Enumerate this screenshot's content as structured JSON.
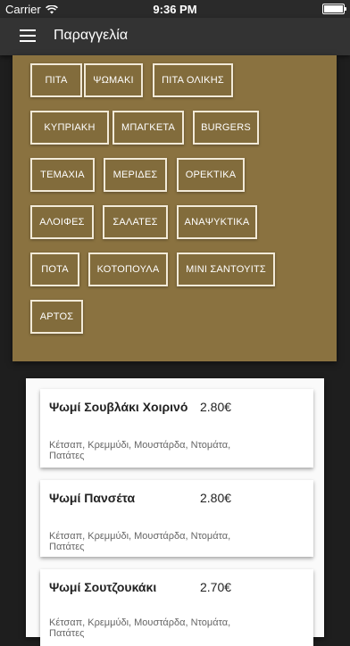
{
  "status": {
    "carrier": "Carrier",
    "time": "9:36 PM"
  },
  "appbar": {
    "title": "Παραγγελία"
  },
  "categories": [
    "ΠΙΤΑ",
    "ΨΩΜΑΚΙ",
    "ΠΙΤΑ ΟΛΙΚΗΣ",
    "ΚΥΠΡΙΑΚΗ",
    "ΜΠΑΓΚΕΤΑ",
    "BURGERS",
    "ΤΕΜΑΧΙΑ",
    "ΜΕΡΙΔΕΣ",
    "ΟΡΕΚΤΙΚΑ",
    "ΑΛΟΙΦΕΣ",
    "ΣΑΛΑΤΕΣ",
    "ΑΝΑΨΥΚΤΙΚΑ",
    "ΠΟΤΑ",
    "ΚΟΤΟΠΟΥΛΑ",
    "ΜΙΝΙ ΣΑΝΤΟΥΙΤΣ",
    "ΑΡΤΟΣ"
  ],
  "items": [
    {
      "name": "Ψωμί Σουβλάκι Χοιρινό",
      "price": "2.80€",
      "desc": "Κέτσαπ, Κρεμμύδι, Μουστάρδα, Ντομάτα, Πατάτες"
    },
    {
      "name": "Ψωμί Πανσέτα",
      "price": "2.80€",
      "desc": "Κέτσαπ, Κρεμμύδι, Μουστάρδα, Ντομάτα, Πατάτες"
    },
    {
      "name": "Ψωμί Σουτζουκάκι",
      "price": "2.70€",
      "desc": "Κέτσαπ, Κρεμμύδι, Μουστάρδα, Ντομάτα, Πατάτες"
    }
  ],
  "colors": {
    "panel": "#8a7240",
    "appbar": "#333333",
    "background": "#1e1e1e"
  }
}
